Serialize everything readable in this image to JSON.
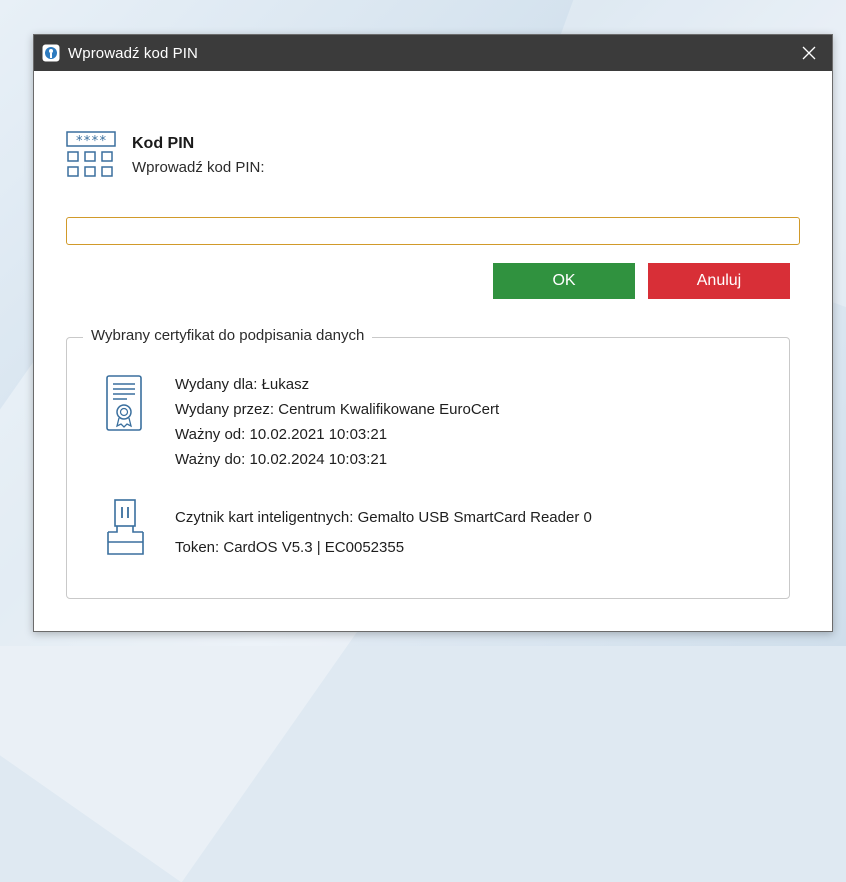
{
  "window": {
    "title": "Wprowadź kod PIN",
    "close_glyph": "✕"
  },
  "header": {
    "icon": "pin-keypad-icon",
    "title": "Kod PIN",
    "subtitle": "Wprowadź kod PIN:"
  },
  "pin_input": {
    "value": "",
    "placeholder": ""
  },
  "buttons": {
    "ok_label": "OK",
    "cancel_label": "Anuluj"
  },
  "certificate": {
    "legend": "Wybrany certyfikat do podpisania danych",
    "icon": "certificate-icon",
    "issued_to": "Wydany dla: Łukasz",
    "issued_by": "Wydany przez: Centrum Kwalifikowane EuroCert",
    "valid_from": "Ważny od: 10.02.2021 10:03:21",
    "valid_to": "Ważny do: 10.02.2024 10:03:21"
  },
  "reader": {
    "icon": "smartcard-reader-icon",
    "reader_name": "Czytnik kart inteligentnych: Gemalto USB SmartCard Reader 0",
    "token": "Token: CardOS V5.3 | EC0052355"
  },
  "colors": {
    "titlebar": "#3b3b3b",
    "ok": "#30923f",
    "cancel": "#d82f37",
    "input_focus": "#d19a2a"
  }
}
